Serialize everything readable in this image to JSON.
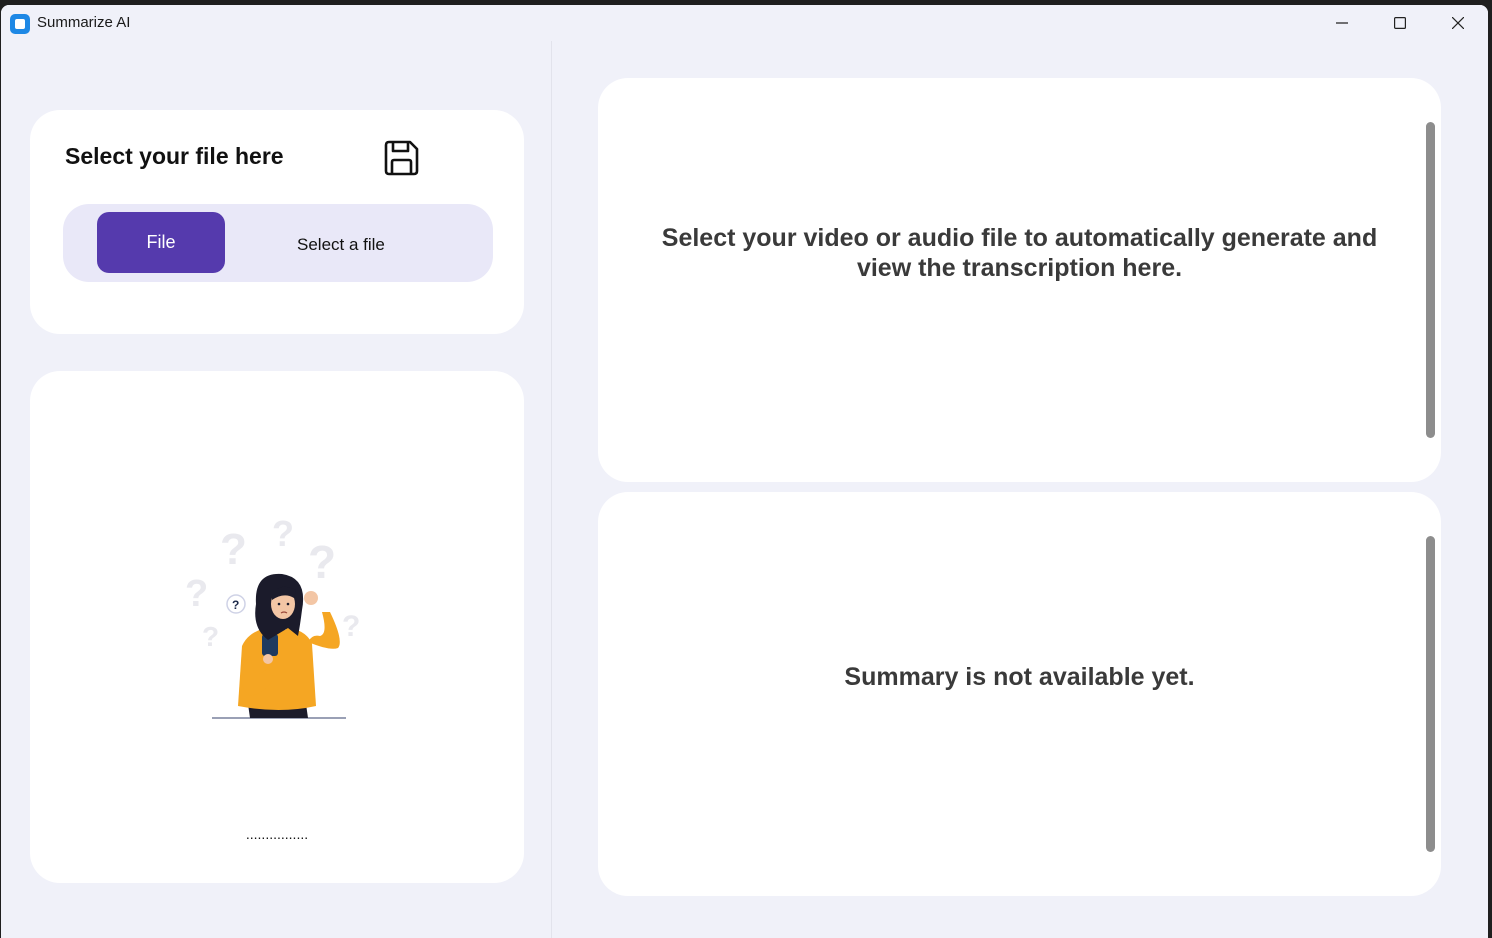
{
  "window": {
    "title": "Summarize AI",
    "controls": [
      "minimize",
      "maximize",
      "close"
    ]
  },
  "file_panel": {
    "heading": "Select your file here",
    "icon": "save-icon",
    "button_label": "File",
    "status_text": "Select a file"
  },
  "status_panel": {
    "illustration": "confused-person-illustration",
    "progress_text": "................"
  },
  "transcription_panel": {
    "message": "Select your video or audio file to automatically generate and view the transcription here."
  },
  "summary_panel": {
    "message": "Summary is not available yet."
  },
  "colors": {
    "window_background": "#f0f1f9",
    "card_background": "#ffffff",
    "accent": "#553aad",
    "picker_background": "#e9e8f8",
    "illustration_shirt": "#f5a623",
    "scrollbar": "#8d8d8d"
  }
}
